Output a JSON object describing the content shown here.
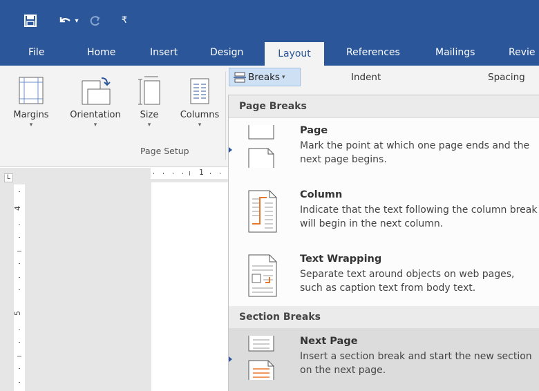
{
  "colors": {
    "brand": "#2b579a",
    "ribbon": "#f3f3f3",
    "highlight": "#dcdcdc",
    "accent_orange": "#e8762b"
  },
  "quick_access": {
    "icons": [
      "save-icon",
      "undo-icon",
      "redo-icon",
      "customize-icon"
    ],
    "undo_caret": "▾",
    "customize_glyph": "₹"
  },
  "tabs": [
    "File",
    "Home",
    "Insert",
    "Design",
    "Layout",
    "References",
    "Mailings",
    "Revie"
  ],
  "active_tab": "Layout",
  "ribbon": {
    "margins_label": "Margins",
    "orientation_label": "Orientation",
    "size_label": "Size",
    "columns_label": "Columns",
    "caret": "▾",
    "group_label": "Page Setup",
    "breaks_label": "Breaks",
    "breaks_caret": "▾",
    "indent_label": "Indent",
    "spacing_label": "Spacing"
  },
  "ruler": {
    "tab_selector": "L",
    "h_number": "1",
    "v_numbers": [
      "4",
      "5"
    ]
  },
  "breaks_menu": {
    "page_breaks_header": "Page Breaks",
    "section_breaks_header": "Section Breaks",
    "items": [
      {
        "title": "Page",
        "description": "Mark the point at which one page ends and the next page begins.",
        "highlighted": false
      },
      {
        "title": "Column",
        "description": "Indicate that the text following the column break will begin in the next column.",
        "highlighted": false
      },
      {
        "title": "Text Wrapping",
        "description": "Separate text around objects on web pages, such as caption text from body text.",
        "highlighted": false
      },
      {
        "title": "Next Page",
        "description": "Insert a section break and start the new section on the next page.",
        "highlighted": true
      }
    ]
  }
}
